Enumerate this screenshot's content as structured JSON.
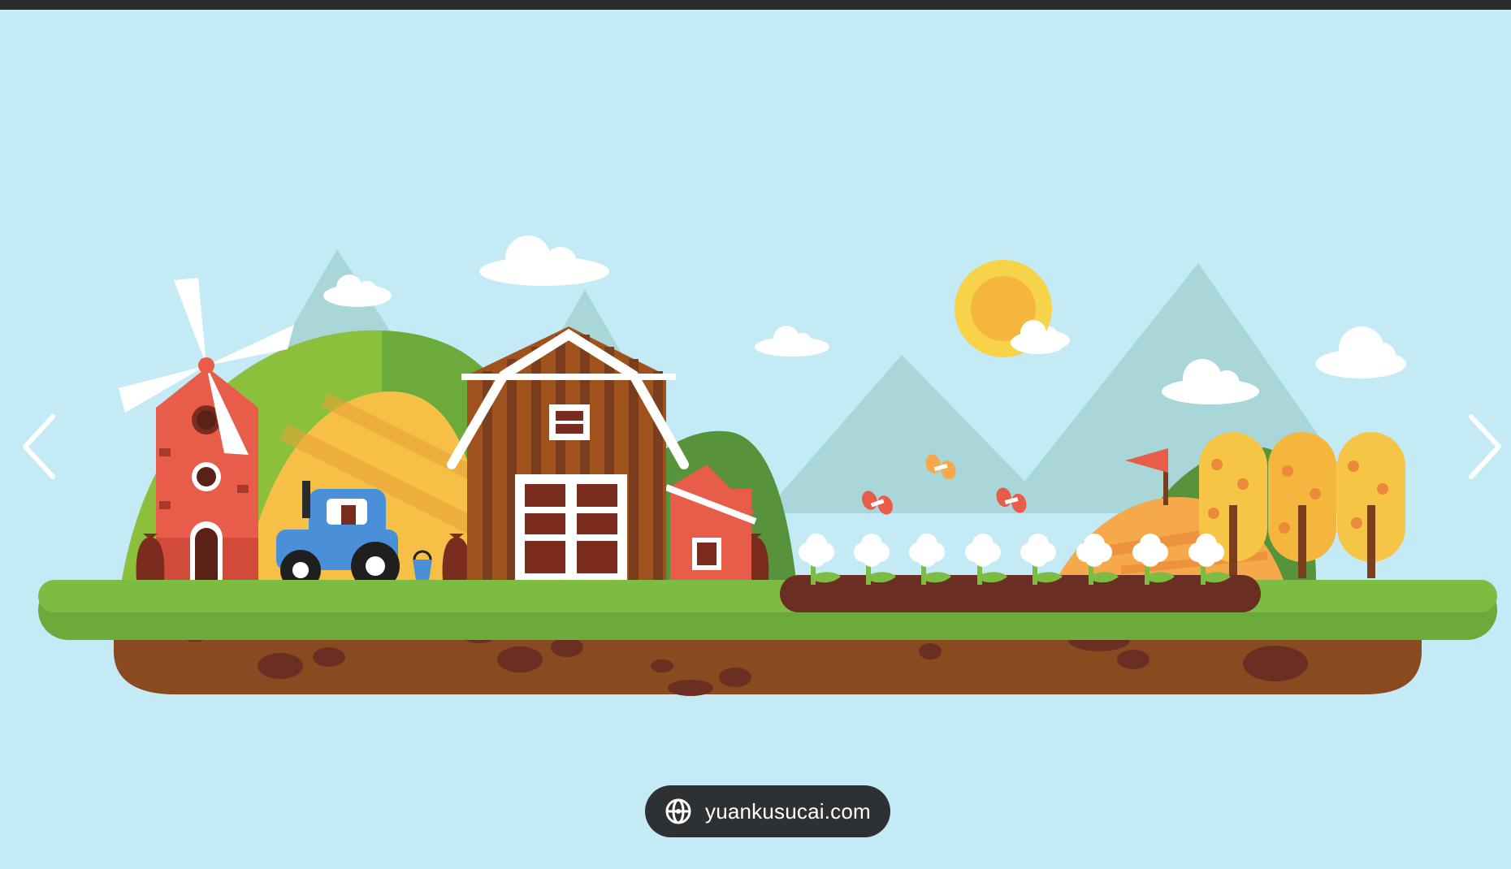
{
  "viewer": {
    "prev_label": "‹",
    "next_label": "›",
    "prev_icon": "chevron-left-icon",
    "next_icon": "chevron-right-icon",
    "source": {
      "icon": "globe-icon",
      "label": "yuankusucai.com"
    }
  },
  "image": {
    "description_colors": {
      "sky": "#c4ebf5",
      "grass": "#6aab3c",
      "soil": "#8a4a1f",
      "barn": "#a0521c",
      "windmill": "#e85c4a",
      "tractor": "#4a90d9",
      "sun": "#f6b93b"
    }
  }
}
